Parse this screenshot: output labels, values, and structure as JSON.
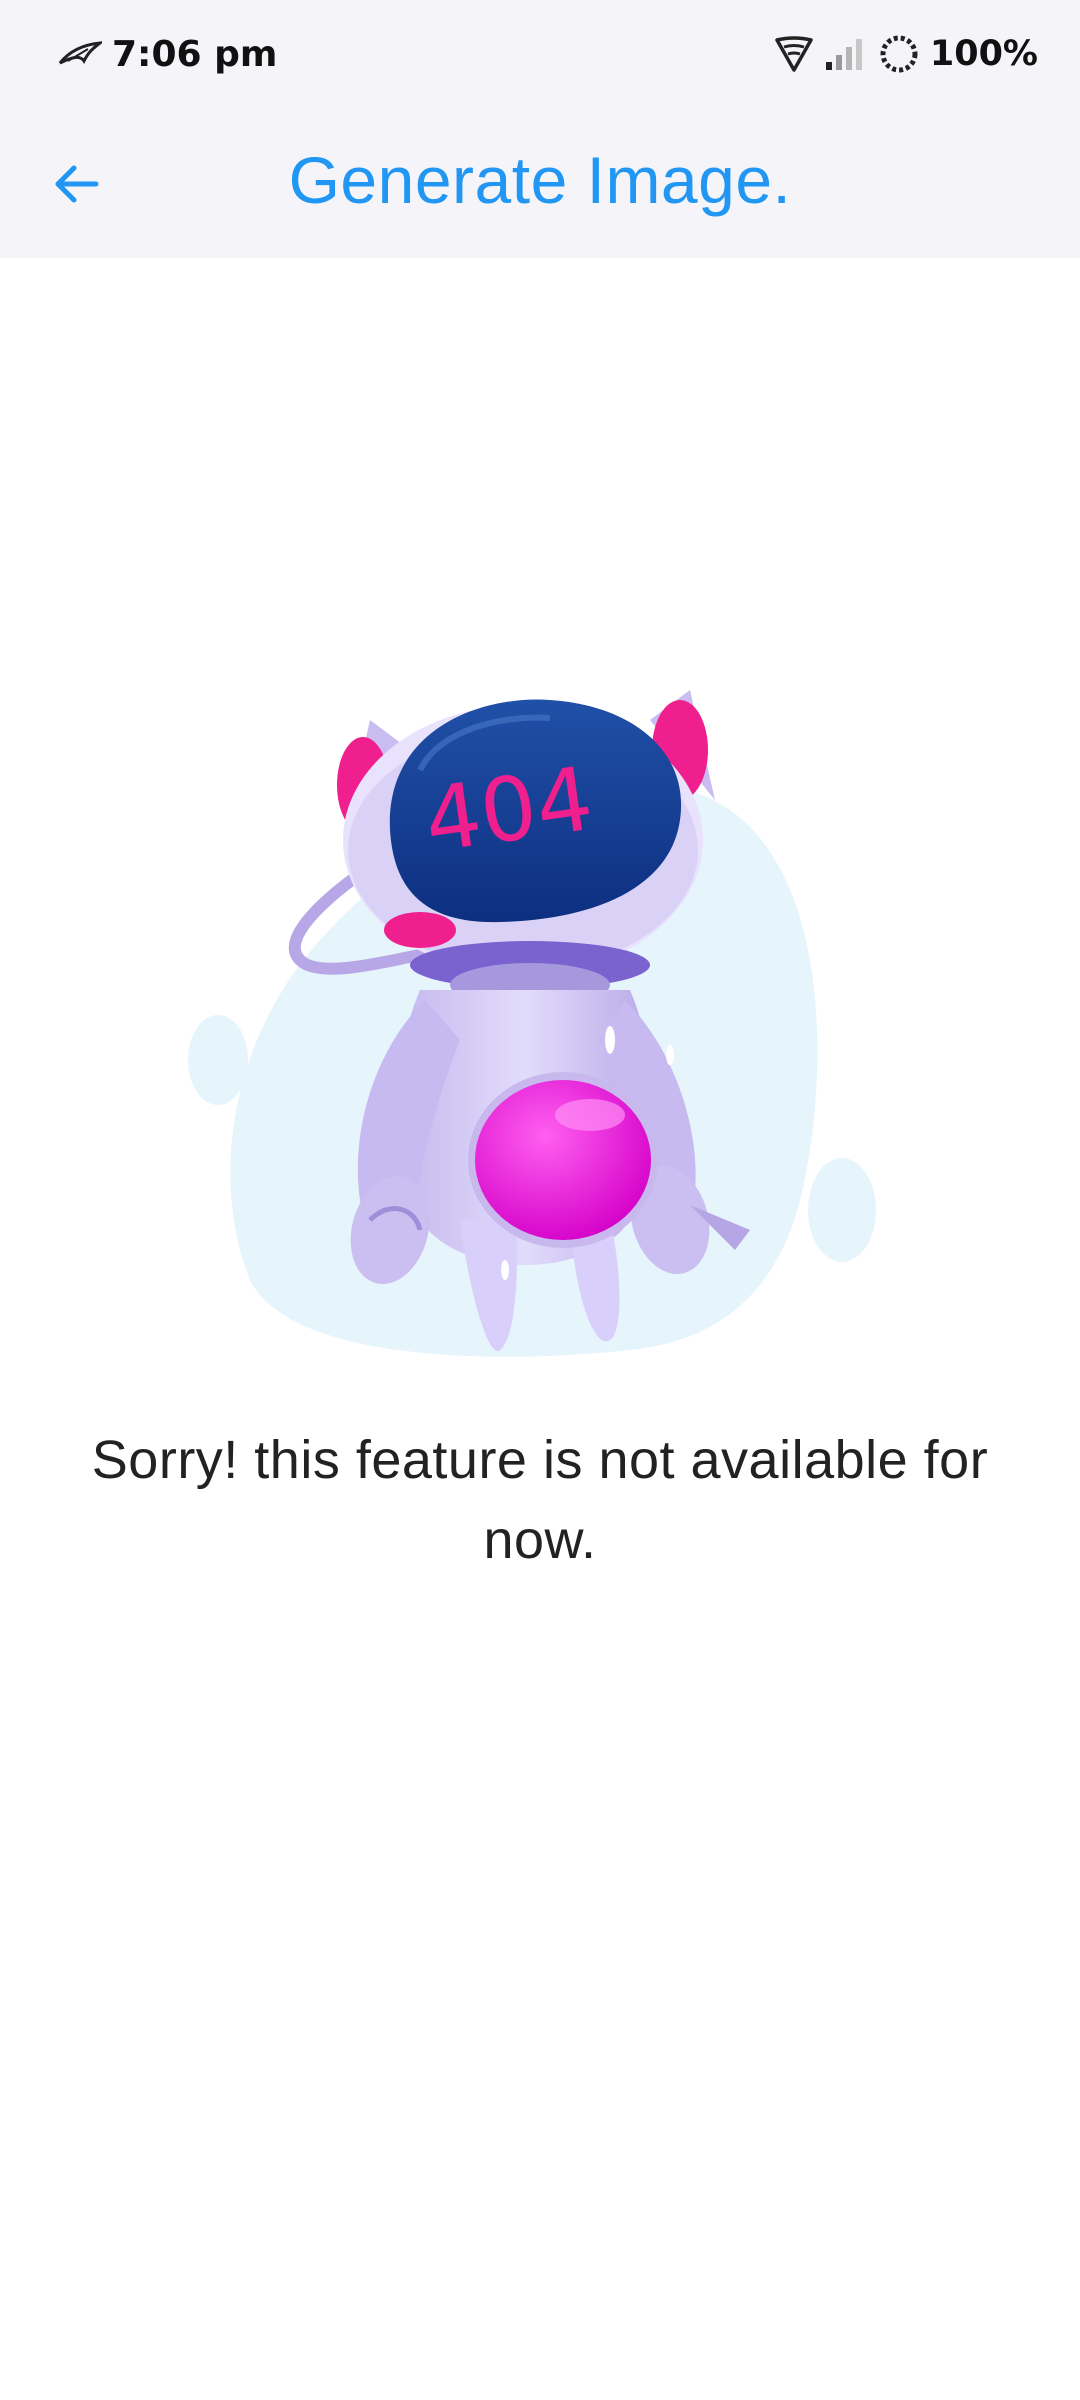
{
  "status_bar": {
    "time": "7:06 pm",
    "battery": "100%",
    "icons": [
      "rog-logo-icon",
      "wifi-icon",
      "cellular-signal-icon",
      "loading-ring-icon"
    ]
  },
  "app_bar": {
    "back_icon": "arrow-left-icon",
    "title": "Generate Image."
  },
  "illustration": {
    "icon": "robot-404-illustration",
    "visor_text": "404"
  },
  "message": "Sorry! this feature is not available for now.",
  "colors": {
    "accent": "#2196f3",
    "top_bar_bg": "#f5f5f9",
    "text": "#222222"
  }
}
